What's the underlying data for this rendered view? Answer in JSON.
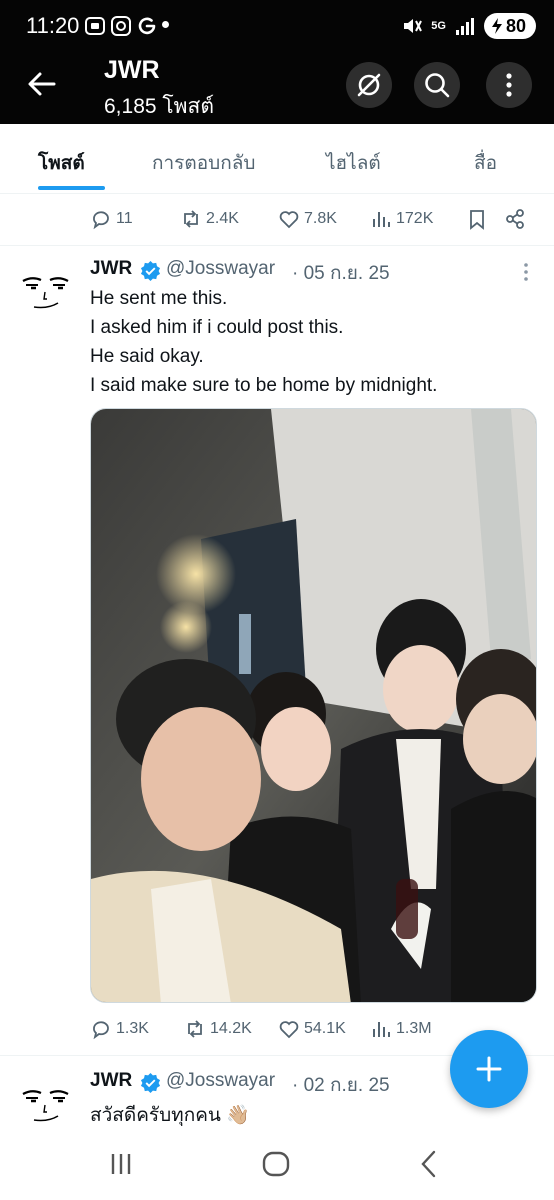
{
  "status_bar": {
    "time": "11:20",
    "network": "5G",
    "battery": "80"
  },
  "header": {
    "title": "JWR",
    "post_count": "6,185 โพสต์"
  },
  "tabs": [
    {
      "label": "โพสต์",
      "active": true
    },
    {
      "label": "การตอบกลับ",
      "active": false
    },
    {
      "label": "ไฮไลต์",
      "active": false
    },
    {
      "label": "สื่อ",
      "active": false
    }
  ],
  "prev_tweet_actions": {
    "replies": "11",
    "retweets": "2.4K",
    "likes": "7.8K",
    "views": "172K"
  },
  "tweet1": {
    "name": "JWR",
    "handle": "@Josswayar",
    "date": "· 05 ก.ย. 25",
    "lines": [
      "He sent me this.",
      "I asked him if i could post this.",
      "He said okay.",
      "I said make sure to be home by midnight."
    ],
    "actions": {
      "replies": "1.3K",
      "retweets": "14.2K",
      "likes": "54.1K",
      "views": "1.3M"
    }
  },
  "tweet2": {
    "name": "JWR",
    "handle": "@Josswayar",
    "date": "· 02 ก.ย. 25",
    "text": "สวัสดีครับทุกคน 👋🏼"
  },
  "colors": {
    "accent": "#1d9bf0",
    "header_bg": "#050505",
    "muted_text": "#536471"
  },
  "icons": [
    "back-arrow-icon",
    "grok-icon",
    "search-icon",
    "more-vertical-icon",
    "reply-icon",
    "retweet-icon",
    "like-icon",
    "views-icon",
    "bookmark-icon",
    "share-icon",
    "verified-icon",
    "compose-plus-icon"
  ]
}
